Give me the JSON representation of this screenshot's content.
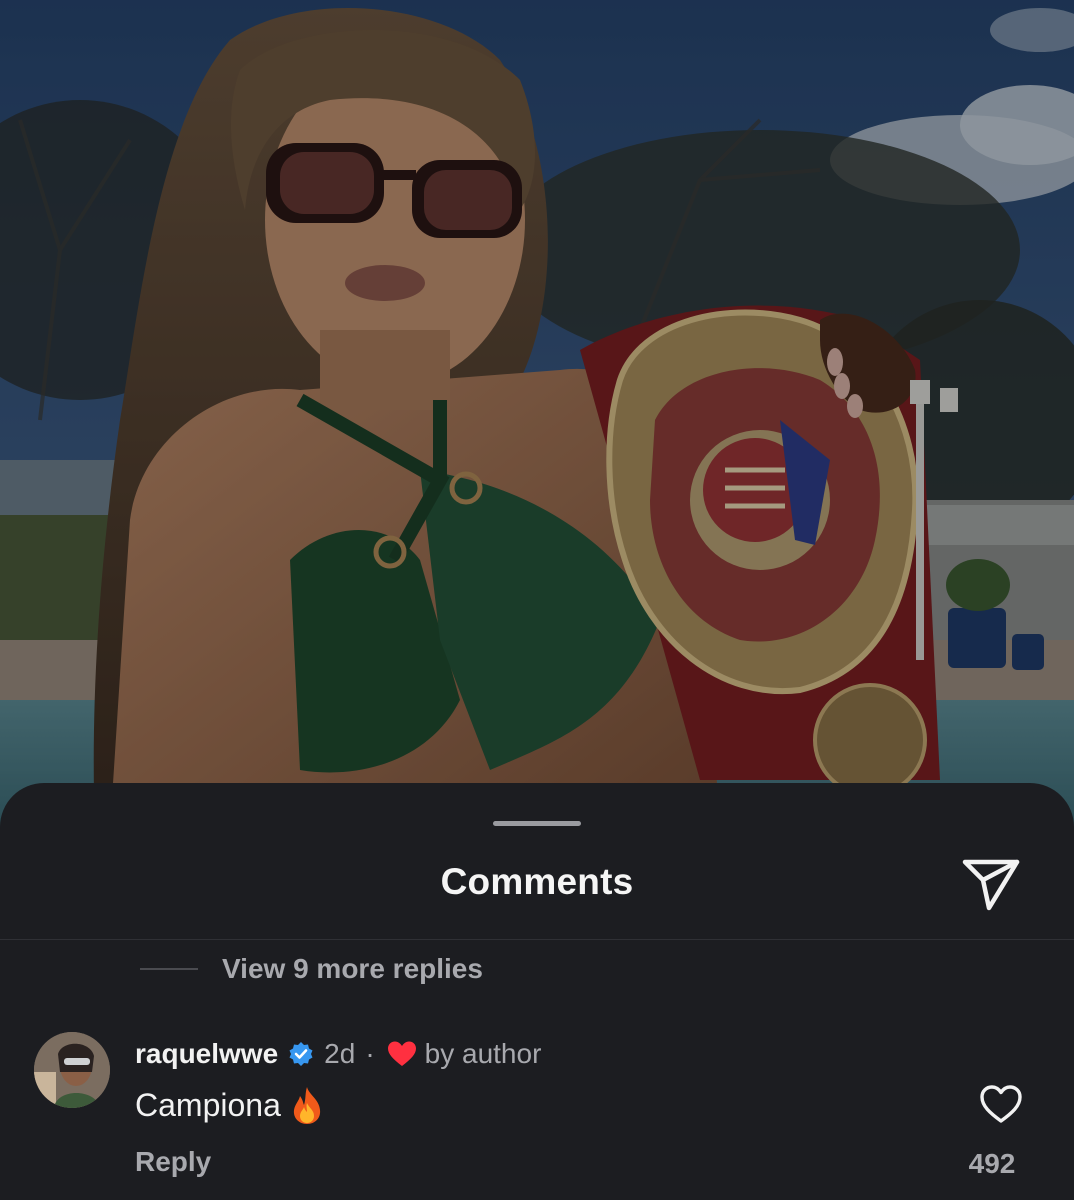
{
  "sheet": {
    "title": "Comments",
    "share_icon": "paper-plane-icon"
  },
  "thread": {
    "view_more_replies": "View 9 more replies"
  },
  "comment": {
    "username": "raquelwwe",
    "verified": true,
    "time": "2d",
    "separator": "·",
    "liked_by": "by author",
    "text": "Campiona",
    "emoji": "fire-emoji",
    "reply_label": "Reply",
    "like_count": "492"
  },
  "colors": {
    "sheet_bg": "#1c1d21",
    "primary_text": "#f2f2f2",
    "secondary_text": "#a8a9ae",
    "verified_blue": "#3797f0",
    "heart_red": "#ff3040"
  }
}
